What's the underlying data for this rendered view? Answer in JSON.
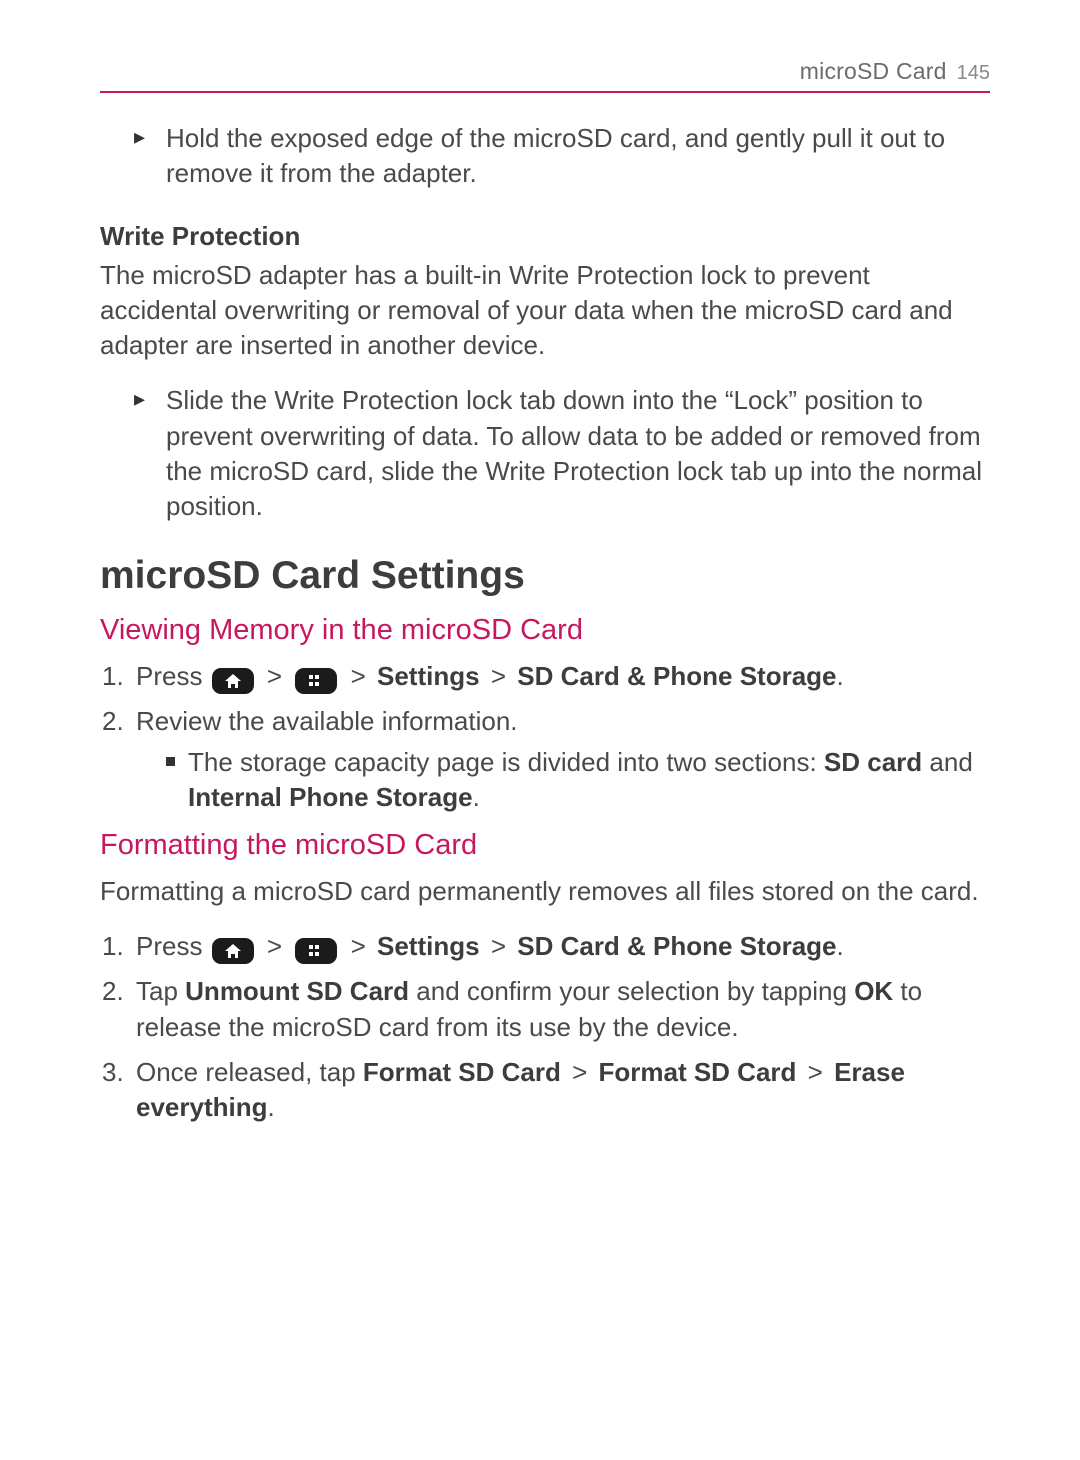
{
  "header": {
    "section": "microSD Card",
    "page": "145"
  },
  "intro_bullet": "Hold the exposed edge of the microSD card, and gently pull it out to remove it from the adapter.",
  "write_protection": {
    "heading": "Write Protection",
    "para": "The microSD adapter has a built-in Write Protection lock to prevent accidental overwriting or removal of your data when the microSD card and adapter are inserted in another device.",
    "bullet": "Slide the Write Protection lock tab down into the “Lock” position to prevent overwriting of data. To allow data to be added or removed from the microSD card, slide the Write Protection lock tab up into the normal position."
  },
  "settings": {
    "heading": "microSD Card Settings",
    "viewing": {
      "heading": "Viewing Memory in the microSD Card",
      "step1_prefix": "Press ",
      "gt": ">",
      "settings_label": "Settings",
      "storage_label": "SD Card & Phone Storage",
      "step2": "Review the available information.",
      "sub_intro": "The storage capacity page is divided into two sections: ",
      "sd_card": "SD card",
      "and": " and ",
      "internal": "Internal Phone Storage",
      "period": "."
    },
    "formatting": {
      "heading": "Formatting the microSD Card",
      "para": "Formatting a microSD card permanently removes all files stored on the card.",
      "step1_prefix": "Press ",
      "step2_pre": "Tap ",
      "unmount": "Unmount SD Card",
      "step2_mid": " and confirm your selection by tapping ",
      "ok": "OK",
      "step2_post": " to release the microSD card from its use by the device.",
      "step3_pre": "Once released, tap ",
      "format1": "Format SD Card",
      "format2": "Format SD Card",
      "erase": "Erase everything"
    }
  },
  "icons": {
    "home": "home-key",
    "apps": "apps-key"
  }
}
